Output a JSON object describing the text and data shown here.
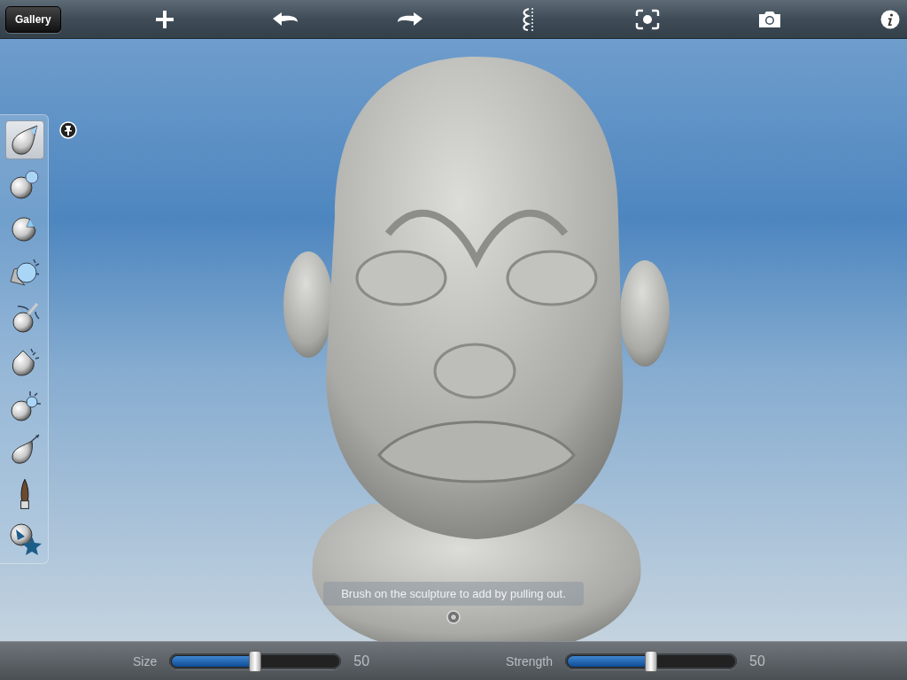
{
  "toolbar": {
    "gallery_button": "Gallery"
  },
  "tools": [
    {
      "selected": true
    },
    {
      "selected": false
    },
    {
      "selected": false
    },
    {
      "selected": false
    },
    {
      "selected": false
    },
    {
      "selected": false
    },
    {
      "selected": false
    },
    {
      "selected": false
    },
    {
      "selected": false
    },
    {
      "selected": false
    }
  ],
  "hint": "Brush on the sculpture to add by pulling out.",
  "sliders": [
    {
      "label": "Size",
      "level": 0.5,
      "reading": "50"
    },
    {
      "label": "Strength",
      "level": 0.5,
      "reading": "50"
    }
  ]
}
